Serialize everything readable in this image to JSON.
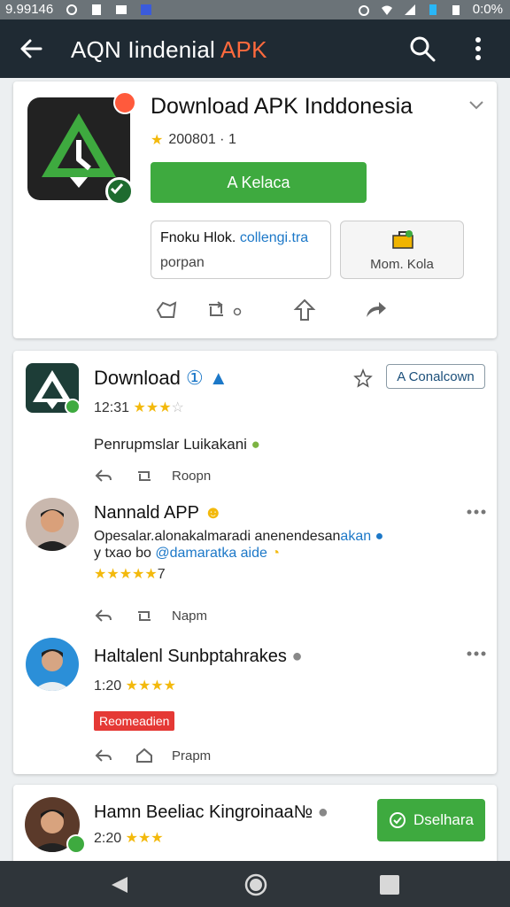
{
  "status_bar": {
    "time": "9.99146",
    "battery": "0:0%"
  },
  "app_bar": {
    "title_main": "AQN Iindenial ",
    "title_accent": "APK"
  },
  "app_card": {
    "title": "Download APK Inddonesia",
    "rating_text": "200801 · 1",
    "install_label": "A Kelaca",
    "info_line1": "Fnoku Hlok. ",
    "info_line1_link": "collengi.tra",
    "info_line2": "porpan",
    "more_label": "Mom. Kola",
    "colors": {
      "accent": "#3eaa3f",
      "brand": "#1f2a33",
      "badge": "#ff5a3c"
    }
  },
  "feed": {
    "post": {
      "title": "Download",
      "title_extra": "①",
      "meta": "12:31",
      "rating": 3,
      "follow_label": "A Conalcown",
      "text": "Penrupmslar Luikakani",
      "action_label": "Roopn"
    },
    "reviews": [
      {
        "name": "Nannald APP",
        "line1": "Opesalar.alonakalmaradi anenendesan",
        "line1_link": "akan",
        "line2": "y txao bo ",
        "line2_link": "@damaratka aide",
        "rating": 5,
        "rating_suffix": "7",
        "action_label": "Napm"
      },
      {
        "name": "Haltalenl Sunbptahrakes",
        "meta": "1:20",
        "rating": 4,
        "tag": "Reomeadien",
        "action_label": "Prapm"
      }
    ],
    "bottom_review": {
      "name": "Hamn Beeliac Kingroinaa№",
      "meta": "2:20",
      "rating": 3,
      "button_label": "Dselhara"
    }
  }
}
